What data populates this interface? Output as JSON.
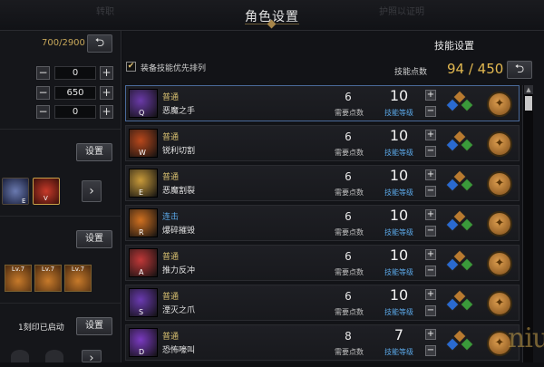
{
  "window": {
    "title": "角色设置",
    "ghost_left": "转职",
    "ghost_right": "护照以证明"
  },
  "left": {
    "skill_points": "700/2900",
    "stats": [
      {
        "value": "0"
      },
      {
        "value": "650"
      },
      {
        "value": "0"
      }
    ],
    "set_label": "设置",
    "engrave_text": "1刻印已启动",
    "badges": [
      {
        "label": "Lv.7"
      },
      {
        "label": "Lv.7"
      },
      {
        "label": "Lv.7"
      }
    ],
    "icon_key_labels": [
      "E",
      "V"
    ]
  },
  "right": {
    "title": "技能设置",
    "checkbox_label": "装备技能优先排列",
    "points_label": "技能点数",
    "points_value": "94 / 450",
    "req_label": "需要点数",
    "level_label": "技能等级"
  },
  "skills": [
    {
      "key": "Q",
      "type": "普通",
      "name": "恶魔之手",
      "req": "6",
      "level": "10",
      "color": "#6a3aa8"
    },
    {
      "key": "W",
      "type": "普通",
      "name": "锐利切割",
      "req": "6",
      "level": "10",
      "color": "#b8481c"
    },
    {
      "key": "E",
      "type": "普通",
      "name": "恶魔割裂",
      "req": "6",
      "level": "10",
      "color": "#c89a3a"
    },
    {
      "key": "R",
      "type": "连击",
      "name": "爆碎摧毁",
      "req": "6",
      "level": "10",
      "color": "#d07020"
    },
    {
      "key": "A",
      "type": "普通",
      "name": "推力反冲",
      "req": "6",
      "level": "10",
      "color": "#c03838"
    },
    {
      "key": "S",
      "type": "普通",
      "name": "湮灭之爪",
      "req": "6",
      "level": "10",
      "color": "#6a3ab0"
    },
    {
      "key": "D",
      "type": "普通",
      "name": "恐怖嚎叫",
      "req": "8",
      "level": "7",
      "color": "#7a3ac0"
    }
  ],
  "watermark": "niu"
}
